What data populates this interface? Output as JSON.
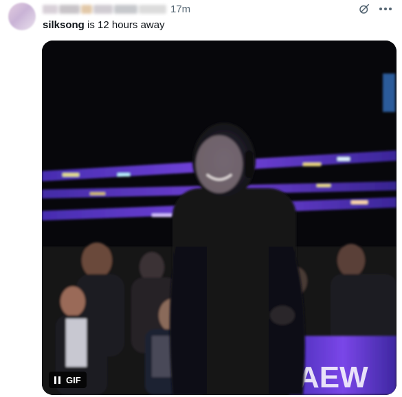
{
  "post": {
    "timestamp": "17m",
    "text_bold": "silksong",
    "text_rest": " is 12 hours away"
  },
  "media": {
    "badge_label": "GIF",
    "arena_logo_text": "AEW"
  },
  "icons": {
    "grok": "grok-icon",
    "more": "more-icon",
    "pause": "pause-icon"
  },
  "colors": {
    "text_primary": "#0f1419",
    "text_secondary": "#536471",
    "arena_purple": "#6d3ce0"
  }
}
